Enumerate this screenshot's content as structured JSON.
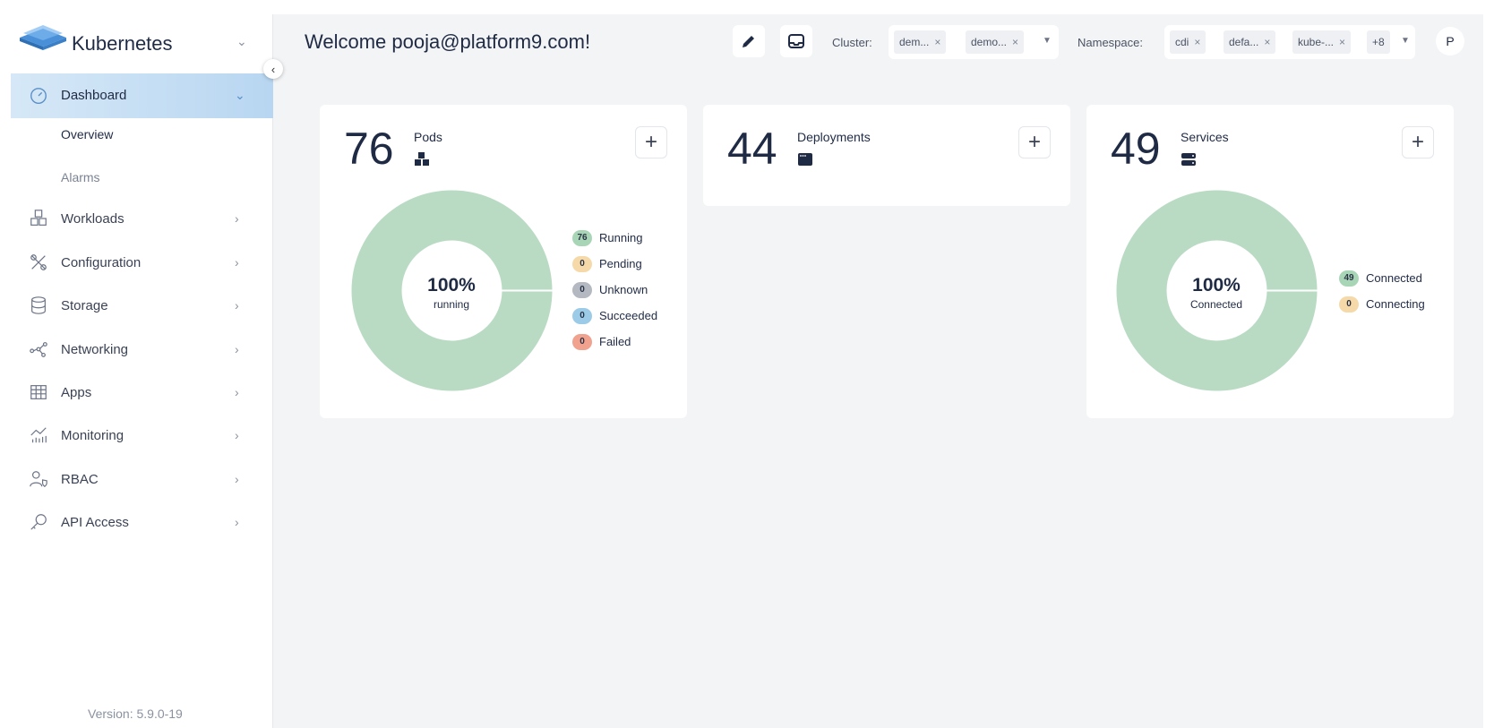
{
  "brand": {
    "title": "Kubernetes"
  },
  "header": {
    "welcome": "Welcome pooja@platform9.com!",
    "cluster_label": "Cluster:",
    "cluster_chips": [
      "dem...",
      "demo..."
    ],
    "namespace_label": "Namespace:",
    "namespace_chips": [
      "cdi",
      "defa...",
      "kube-..."
    ],
    "namespace_more": "+8",
    "avatar_initial": "P"
  },
  "sidebar": {
    "dashboard": "Dashboard",
    "sub_items": [
      "Overview",
      "Alarms"
    ],
    "items": [
      "Workloads",
      "Configuration",
      "Storage",
      "Networking",
      "Apps",
      "Monitoring",
      "RBAC",
      "API Access"
    ],
    "version": "Version: 5.9.0-19"
  },
  "cards": {
    "pods": {
      "count": "76",
      "title": "Pods",
      "center_pct": "100%",
      "center_sub": "running",
      "legend": [
        {
          "value": "76",
          "label": "Running",
          "color": "#a9d5b7"
        },
        {
          "value": "0",
          "label": "Pending",
          "color": "#f6d9a8"
        },
        {
          "value": "0",
          "label": "Unknown",
          "color": "#b4b8c0"
        },
        {
          "value": "0",
          "label": "Succeeded",
          "color": "#9ccbe8"
        },
        {
          "value": "0",
          "label": "Failed",
          "color": "#f0a28f"
        }
      ]
    },
    "deployments": {
      "count": "44",
      "title": "Deployments"
    },
    "services": {
      "count": "49",
      "title": "Services",
      "center_pct": "100%",
      "center_sub": "Connected",
      "legend": [
        {
          "value": "49",
          "label": "Connected",
          "color": "#a9d5b7"
        },
        {
          "value": "0",
          "label": "Connecting",
          "color": "#f6d9a8"
        }
      ]
    }
  },
  "colors": {
    "donut_fill": "#b9dbc3",
    "active_nav": "#cfe4f6"
  }
}
